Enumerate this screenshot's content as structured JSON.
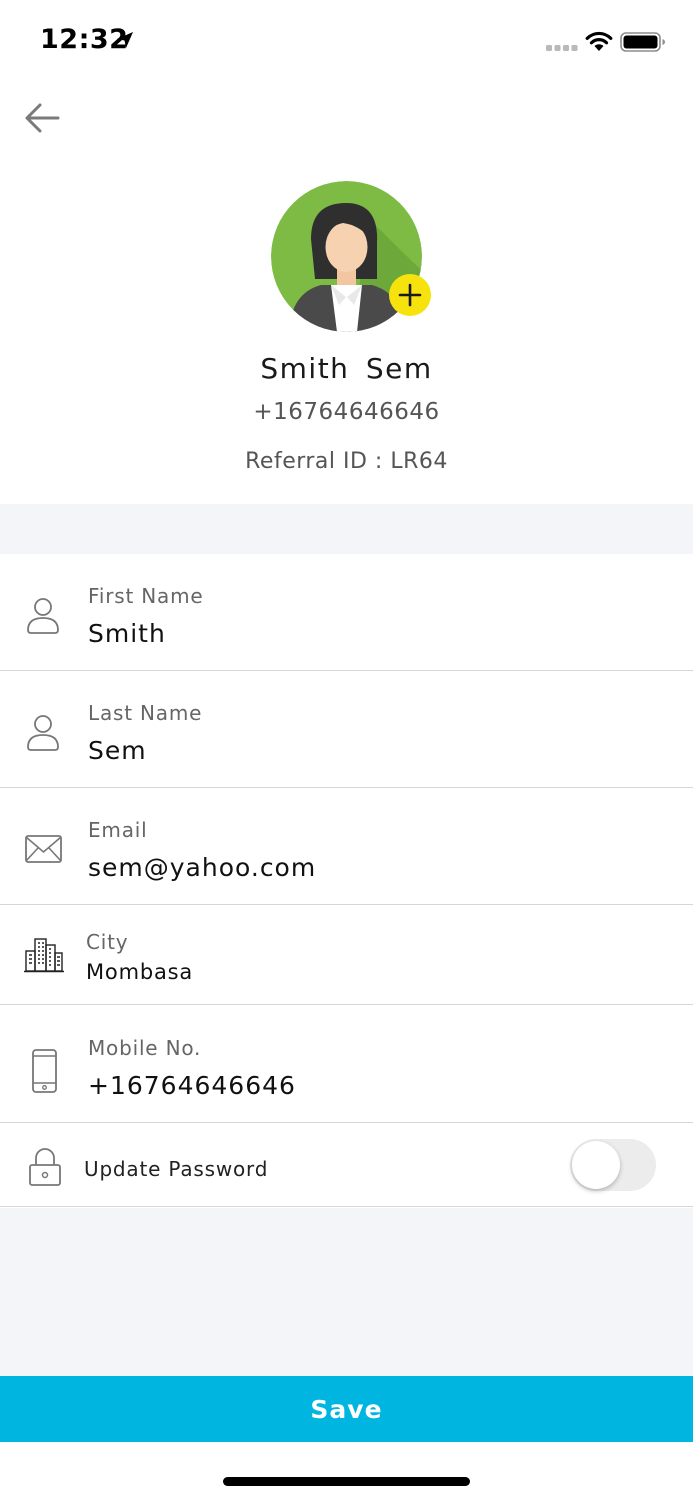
{
  "status_bar": {
    "time": "12:32",
    "icons": [
      "location-arrow-icon",
      "cellular-signal-icon",
      "wifi-icon",
      "battery-icon"
    ]
  },
  "header": {
    "back_icon": "back-arrow-icon"
  },
  "profile": {
    "name": "Smith  Sem",
    "phone": "+16764646646",
    "referral": "Referral ID : LR64",
    "add_photo_icon": "plus-icon"
  },
  "fields": {
    "first_name": {
      "label": "First Name",
      "value": "Smith",
      "icon": "user-icon"
    },
    "last_name": {
      "label": "Last Name",
      "value": "Sem",
      "icon": "user-icon"
    },
    "email": {
      "label": "Email",
      "value": "sem@yahoo.com",
      "icon": "envelope-icon"
    },
    "city": {
      "label": "City",
      "value": "Mombasa",
      "icon": "city-buildings-icon"
    },
    "mobile": {
      "label": "Mobile No.",
      "value": "+16764646646",
      "icon": "mobile-phone-icon"
    }
  },
  "update_password": {
    "label": "Update Password",
    "enabled": false,
    "icon": "lock-icon"
  },
  "actions": {
    "save_label": "Save"
  },
  "colors": {
    "accent": "#00b5e0",
    "badge": "#f6e20d",
    "avatar_bg": "#7dbb44",
    "page_gray": "#f3f5f9"
  }
}
